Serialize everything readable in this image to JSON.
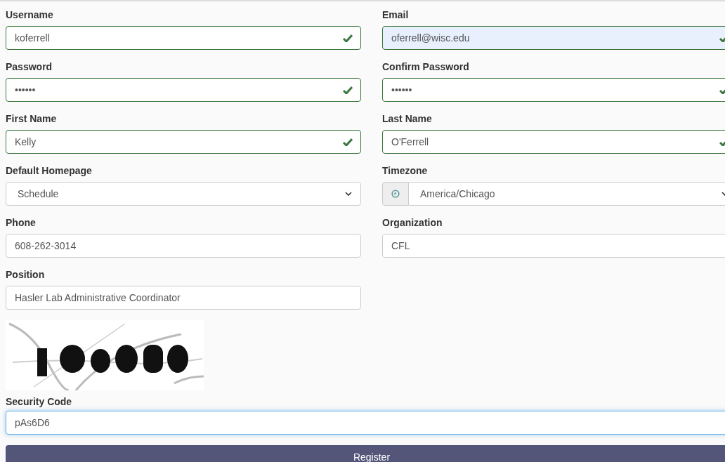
{
  "fields": [
    {
      "label": "Username",
      "kind": "text",
      "value": "koferrell",
      "valid": true,
      "autofilled": false
    },
    {
      "label": "Email",
      "kind": "text",
      "value": "oferrell@wisc.edu",
      "valid": true,
      "autofilled": true
    },
    {
      "label": "Password",
      "kind": "text",
      "value": "••••••",
      "valid": true,
      "autofilled": false
    },
    {
      "label": "Confirm Password",
      "kind": "text",
      "value": "••••••",
      "valid": true,
      "autofilled": false
    },
    {
      "label": "First Name",
      "kind": "text",
      "value": "Kelly",
      "valid": true,
      "autofilled": false
    },
    {
      "label": "Last Name",
      "kind": "text",
      "value": "O'Ferrell",
      "valid": true,
      "autofilled": false
    },
    {
      "label": "Default Homepage",
      "kind": "select",
      "value": "Schedule"
    },
    {
      "label": "Timezone",
      "kind": "timezone",
      "value": "America/Chicago"
    },
    {
      "label": "Phone",
      "kind": "text",
      "value": "608-262-3014",
      "valid": false,
      "autofilled": false
    },
    {
      "label": "Organization",
      "kind": "text",
      "value": "CFL",
      "valid": false,
      "autofilled": false
    },
    {
      "label": "Position",
      "kind": "text",
      "value": "Hasler Lab Administrative Coordinator",
      "valid": false,
      "autofilled": false
    }
  ],
  "security_code": {
    "label": "Security Code",
    "value": "pAs6D6",
    "focused": true
  },
  "register_button": "Register"
}
